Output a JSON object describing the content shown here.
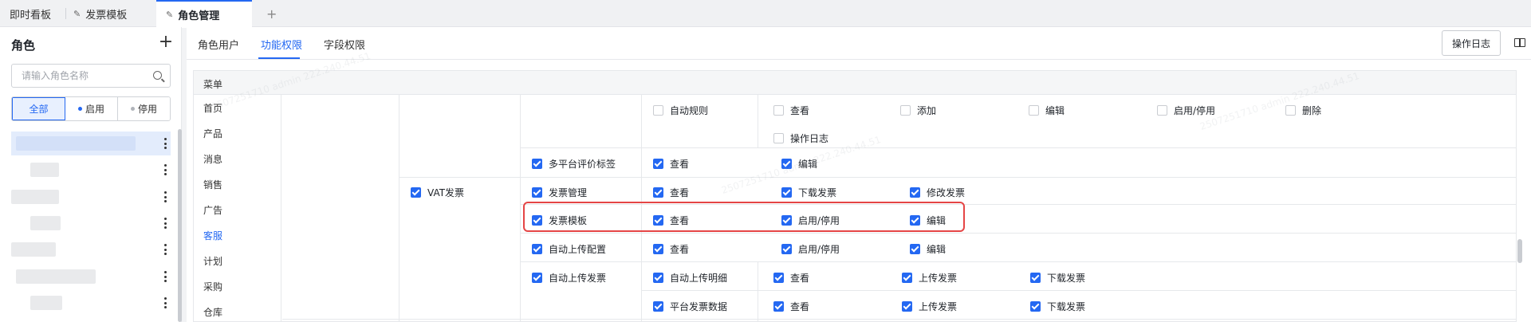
{
  "tabs": [
    {
      "label": "即时看板",
      "pinned": false,
      "active": false
    },
    {
      "label": "发票模板",
      "pinned": true,
      "active": false
    },
    {
      "label": "角色管理",
      "pinned": true,
      "active": true
    }
  ],
  "add_tab": "+",
  "sidebar": {
    "title": "角色",
    "add": "+",
    "search_placeholder": "请输入角色名称",
    "filters": [
      "全部",
      "启用",
      "停用"
    ],
    "filter_dot_colors": [
      "#2468f2",
      "#b0b4ba"
    ]
  },
  "subtabs": [
    "角色用户",
    "功能权限",
    "字段权限"
  ],
  "log_button": "操作日志",
  "menu": {
    "header": "菜单",
    "items": [
      "首页",
      "产品",
      "消息",
      "销售",
      "广告",
      "客服",
      "计划",
      "采购",
      "仓库"
    ],
    "active": "客服"
  },
  "permissions": {
    "row0": {
      "col3": {
        "label": "自动规则",
        "checked": false
      },
      "perms": [
        {
          "label": "查看",
          "checked": false
        },
        {
          "label": "添加",
          "checked": false
        },
        {
          "label": "编辑",
          "checked": false
        },
        {
          "label": "启用/停用",
          "checked": false
        },
        {
          "label": "删除",
          "checked": false
        }
      ],
      "extra": {
        "label": "操作日志",
        "checked": false
      }
    },
    "row1": {
      "col2": {
        "label": "多平台评价标签",
        "checked": true
      },
      "perms": [
        {
          "label": "查看",
          "checked": true
        },
        {
          "label": "编辑",
          "checked": true
        }
      ]
    },
    "vat": {
      "label": "VAT发票",
      "checked": true
    },
    "row2": {
      "col2": {
        "label": "发票管理",
        "checked": true
      },
      "perms": [
        {
          "label": "查看",
          "checked": true
        },
        {
          "label": "下载发票",
          "checked": true
        },
        {
          "label": "修改发票",
          "checked": true
        }
      ]
    },
    "row3": {
      "col2": {
        "label": "发票模板",
        "checked": true
      },
      "perms": [
        {
          "label": "查看",
          "checked": true
        },
        {
          "label": "启用/停用",
          "checked": true
        },
        {
          "label": "编辑",
          "checked": true
        }
      ]
    },
    "row4": {
      "col2": {
        "label": "自动上传配置",
        "checked": true
      },
      "perms": [
        {
          "label": "查看",
          "checked": true
        },
        {
          "label": "启用/停用",
          "checked": true
        },
        {
          "label": "编辑",
          "checked": true
        }
      ]
    },
    "row5": {
      "col2": {
        "label": "自动上传发票",
        "checked": true
      },
      "col3": {
        "label": "自动上传明细",
        "checked": true
      },
      "perms": [
        {
          "label": "查看",
          "checked": true
        },
        {
          "label": "上传发票",
          "checked": true
        },
        {
          "label": "下载发票",
          "checked": true
        }
      ]
    },
    "row6": {
      "col3": {
        "label": "平台发票数据",
        "checked": true
      },
      "perms": [
        {
          "label": "查看",
          "checked": true
        },
        {
          "label": "上传发票",
          "checked": true
        },
        {
          "label": "下载发票",
          "checked": true
        }
      ]
    }
  },
  "watermark": "2507251710 admin 222.240.44.51",
  "colors": {
    "accent": "#2468f2",
    "highlight": "#e54545"
  }
}
